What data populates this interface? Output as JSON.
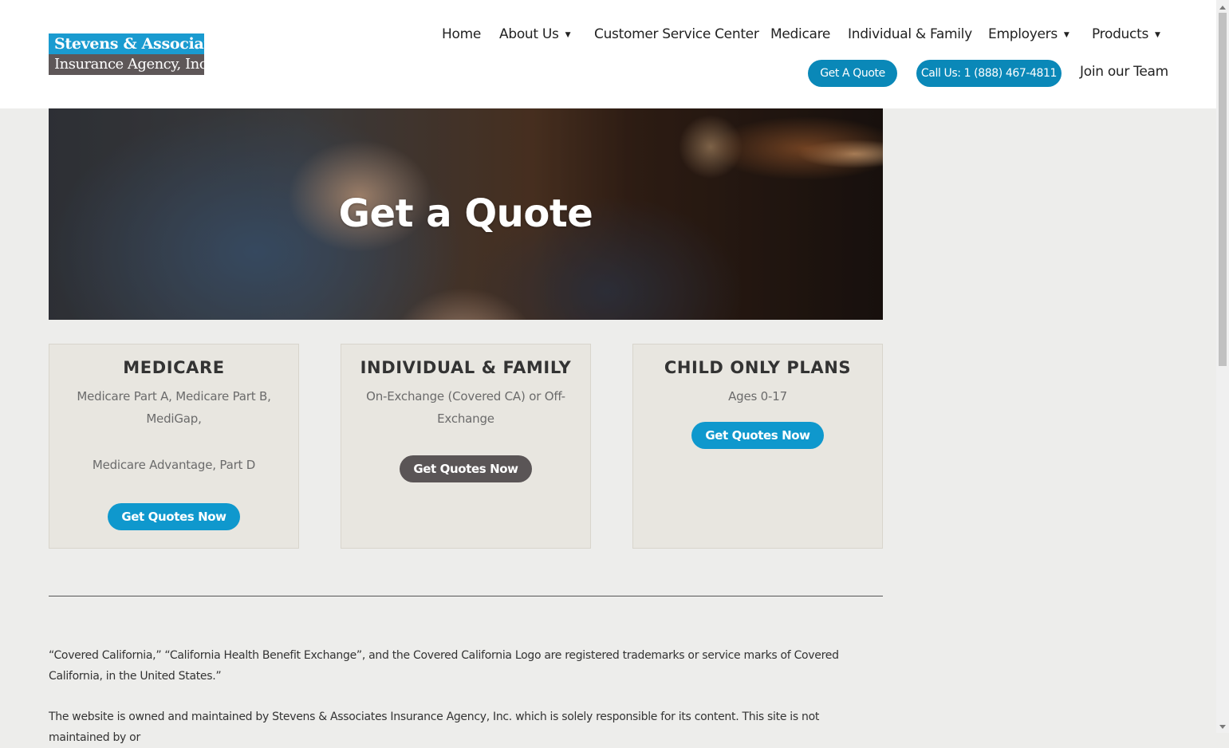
{
  "logo": {
    "line1": "Stevens & Associates",
    "line2": "Insurance Agency, Inc."
  },
  "nav": {
    "items": [
      {
        "label": "Home"
      },
      {
        "label": "About Us",
        "dropdown": true
      },
      {
        "label": "Customer Service Center"
      },
      {
        "label": "Medicare"
      },
      {
        "label": "Individual & Family"
      },
      {
        "label": "Employers",
        "dropdown": true
      },
      {
        "label": "Products",
        "dropdown": true
      }
    ],
    "caret_glyph": "▼",
    "get_quote": "Get A Quote",
    "call_us": "Call Us: 1 (888) 467-4811",
    "join_team": "Join our Team"
  },
  "hero": {
    "title": "Get a Quote"
  },
  "cards": [
    {
      "title": "MEDICARE",
      "text1": "Medicare Part A, Medicare Part B, MediGap,",
      "text2": "Medicare Advantage, Part D",
      "button": "Get Quotes Now",
      "button_color": "#0f98cd"
    },
    {
      "title": "INDIVIDUAL & FAMILY",
      "text1": "On-Exchange (Covered CA) or Off-Exchange",
      "button": "Get Quotes Now",
      "button_color": "#5a5556"
    },
    {
      "title": "CHILD ONLY PLANS",
      "text1": "Ages 0-17",
      "button": "Get Quotes Now",
      "button_color": "#0f98cd"
    }
  ],
  "footer": {
    "disclaimer1": "“Covered California,” “California Health Benefit Exchange”, and the Covered California Logo are registered trademarks or service marks of Covered California, in the United States.”",
    "disclaimer2": "The website is owned and maintained by Stevens & Associates Insurance Agency, Inc. which is solely responsible for its content. This site is not maintained by or"
  },
  "colors": {
    "brand_blue": "#1a9bd0",
    "brand_gray": "#5e5758",
    "button_blue": "#0a88b8",
    "page_background": "#ededeb",
    "card_background": "#e8e6e0"
  }
}
